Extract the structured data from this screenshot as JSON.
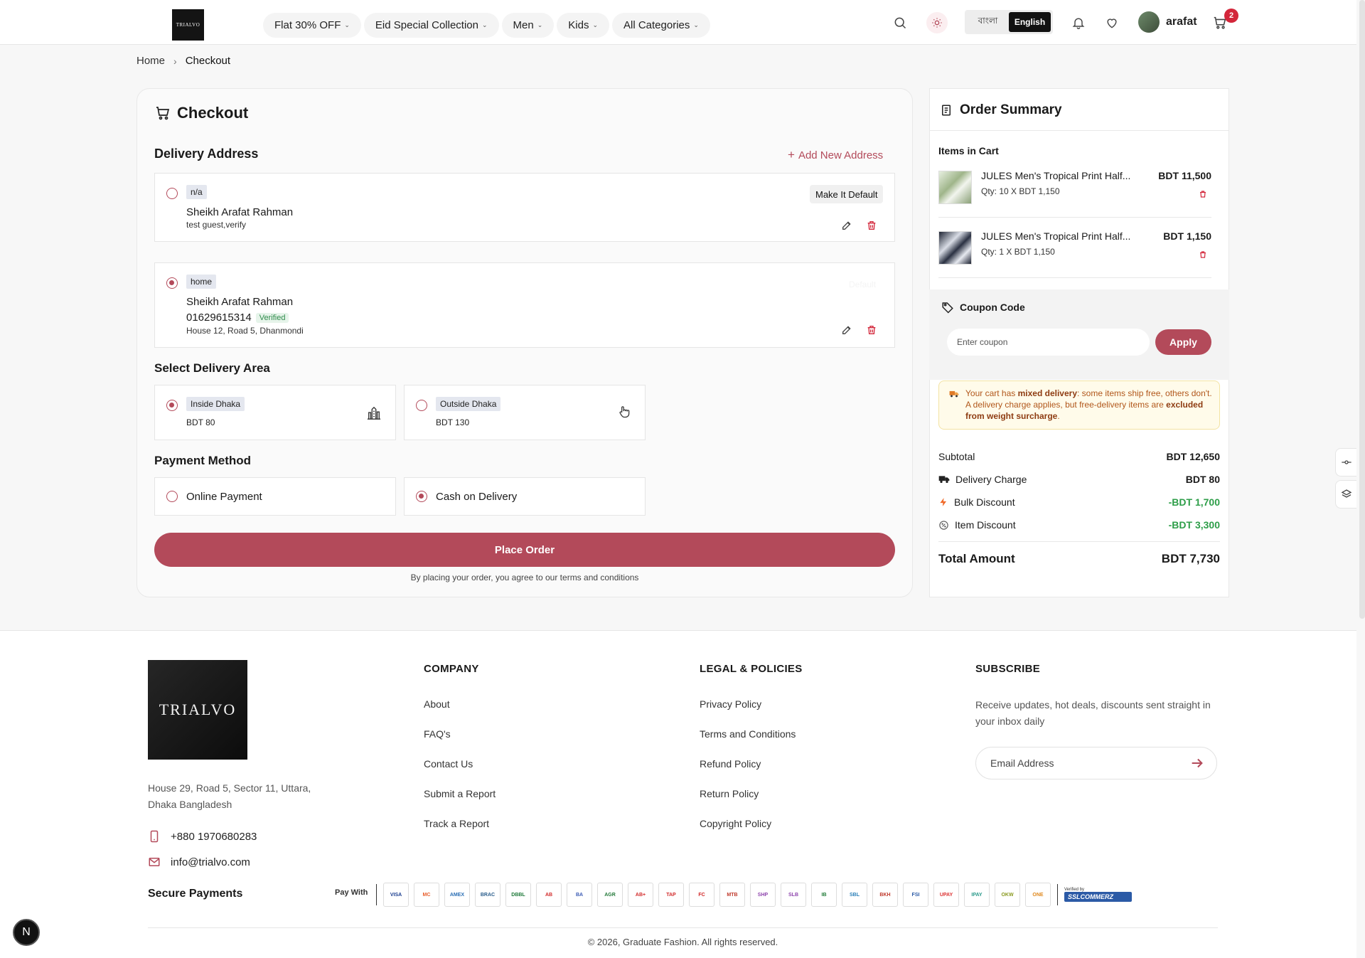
{
  "header": {
    "logo_text": "TRIALVO",
    "nav": [
      "Flat 30% OFF",
      "Eid Special Collection",
      "Men",
      "Kids",
      "All Categories"
    ],
    "lang": [
      "বাংলা",
      "English"
    ],
    "username": "arafat",
    "cart_count": "2"
  },
  "breadcrumb": {
    "home": "Home",
    "current": "Checkout"
  },
  "checkout": {
    "title": "Checkout",
    "delivery_address_title": "Delivery Address",
    "add_new_address": "Add New Address",
    "addresses": [
      {
        "tag": "n/a",
        "name": "Sheikh Arafat Rahman",
        "line": "test guest,verify",
        "make_default": "Make It Default"
      },
      {
        "tag": "home",
        "name": "Sheikh Arafat Rahman",
        "phone": "01629615314",
        "verified": "Verified",
        "line": "House 12, Road 5, Dhanmondi",
        "default_label": "Default"
      }
    ],
    "delivery_area_title": "Select Delivery Area",
    "areas": [
      {
        "label": "Inside Dhaka",
        "price": "BDT 80",
        "selected": true
      },
      {
        "label": "Outside Dhaka",
        "price": "BDT 130",
        "selected": false
      }
    ],
    "payment_title": "Payment Method",
    "payments": [
      {
        "label": "Online Payment",
        "selected": false
      },
      {
        "label": "Cash on Delivery",
        "selected": true
      }
    ],
    "place_order": "Place Order",
    "terms": "By placing your order, you agree to our terms and conditions"
  },
  "summary": {
    "title": "Order Summary",
    "items_label": "Items in Cart",
    "items": [
      {
        "name": "JULES Men's Tropical Print Half...",
        "qty": "Qty: 10 X BDT 1,150",
        "price": "BDT 11,500"
      },
      {
        "name": "JULES Men's Tropical Print Half...",
        "qty": "Qty: 1 X BDT 1,150",
        "price": "BDT 1,150"
      }
    ],
    "coupon_title": "Coupon Code",
    "coupon_placeholder": "Enter coupon",
    "apply": "Apply",
    "notice_pre": "Your cart has ",
    "notice_bold1": "mixed delivery",
    "notice_mid": ": some items ship free, others don't. A delivery charge applies, but free-delivery items are ",
    "notice_bold2": "excluded from weight surcharge",
    "notice_end": ".",
    "rows": [
      {
        "label": "Subtotal",
        "value": "BDT 12,650"
      },
      {
        "label": "Delivery Charge",
        "value": "BDT 80"
      },
      {
        "label": "Bulk Discount",
        "value": "-BDT 1,700"
      },
      {
        "label": "Item Discount",
        "value": "-BDT 3,300"
      }
    ],
    "total_label": "Total Amount",
    "total_value": "BDT 7,730"
  },
  "footer": {
    "logo_text": "TRIALVO",
    "address": "House 29, Road 5, Sector 11, Uttara, Dhaka Bangladesh",
    "phone": "+880 1970680283",
    "email": "info@trialvo.com",
    "company_title": "COMPANY",
    "company_links": [
      "About",
      "FAQ's",
      "Contact Us",
      "Submit a Report",
      "Track a Report"
    ],
    "legal_title": "LEGAL & POLICIES",
    "legal_links": [
      "Privacy Policy",
      "Terms and Conditions",
      "Refund Policy",
      "Return Policy",
      "Copyright Policy"
    ],
    "subscribe_title": "SUBSCRIBE",
    "subscribe_text": "Receive updates, hot deals, discounts sent straight in your inbox daily",
    "email_placeholder": "Email Address",
    "secure_title": "Secure Payments",
    "pay_with": "Pay With",
    "pay_methods": [
      "VISA",
      "MC",
      "AMEX",
      "BRAC",
      "DBBL",
      "AB",
      "BA",
      "AGR",
      "AB+",
      "TAP",
      "FC",
      "MTB",
      "SHP",
      "SLB",
      "IB",
      "SBL",
      "BKH",
      "FSI",
      "UPAY",
      "IPAY",
      "OKW",
      "ONE"
    ],
    "verified_by": "Verified by",
    "ssl": "SSLCOMMERZ",
    "copyright": "© 2026, Graduate Fashion. All rights reserved."
  },
  "colors": {
    "accent": "#b34a5a",
    "green": "#2e9e49",
    "badge": "#d3263a"
  }
}
